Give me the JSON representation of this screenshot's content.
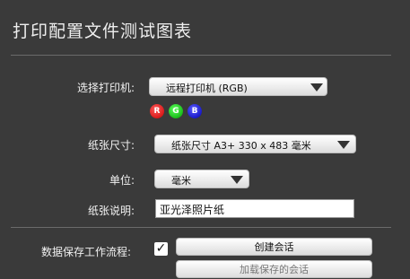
{
  "page": {
    "title": "打印配置文件测试图表"
  },
  "printer": {
    "label": "选择打印机:",
    "selected": "远程打印机 (RGB)",
    "channels": [
      "R",
      "G",
      "B"
    ]
  },
  "paper_size": {
    "label": "纸张尺寸:",
    "selected": "纸张尺寸 A3+ 330 x 483 毫米"
  },
  "unit": {
    "label": "单位:",
    "selected": "毫米"
  },
  "paper_desc": {
    "label": "纸张说明:",
    "value": "亚光泽照片纸"
  },
  "workflow": {
    "label": "数据保存工作流程:",
    "checked": true,
    "create_session": "创建会话",
    "second_button": "加载保存的会话"
  },
  "colors": {
    "background": "#3a3a3a",
    "red": "#c80000",
    "green": "#00a000",
    "blue": "#0000b0"
  }
}
